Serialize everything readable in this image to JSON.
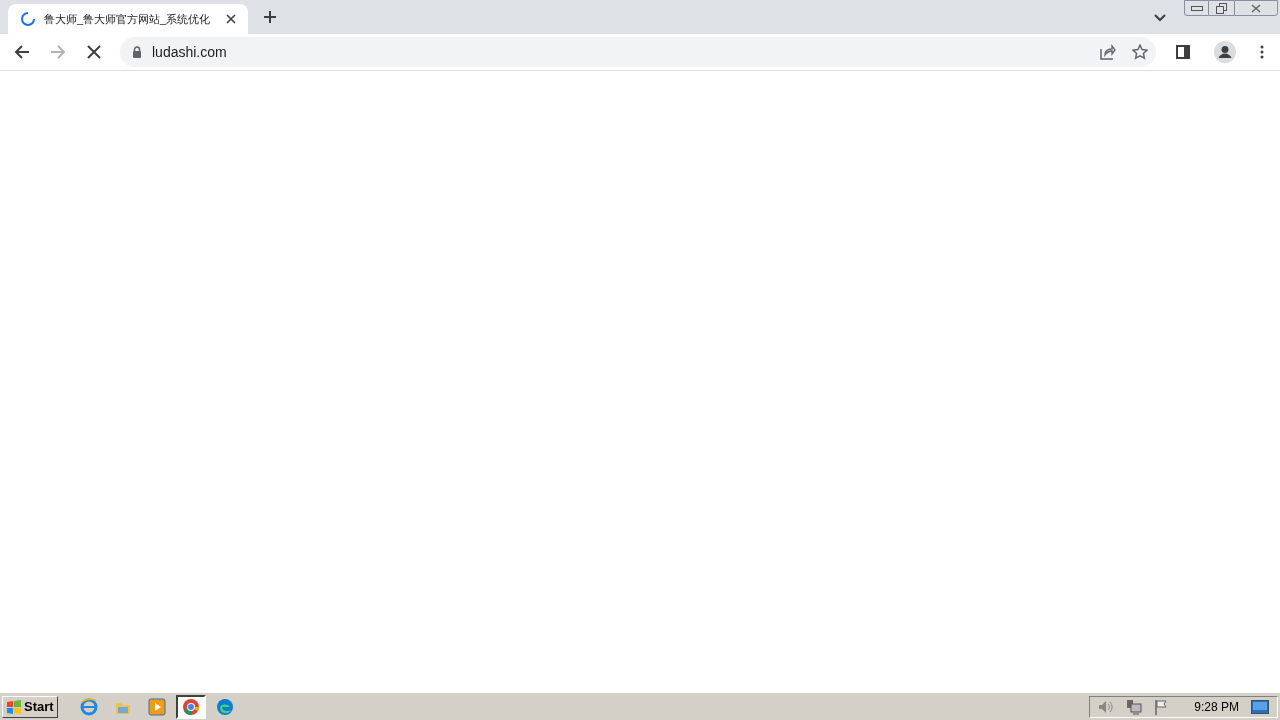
{
  "tabs": [
    {
      "title": "鲁大师_鲁大师官方网站_系统优化",
      "loading": true,
      "selected": true
    }
  ],
  "address_bar": {
    "url": "ludashi.com"
  },
  "page_loading": true,
  "taskbar": {
    "start_label": "Start",
    "apps": [
      {
        "kind": "ie",
        "selected": false
      },
      {
        "kind": "explorer",
        "selected": false
      },
      {
        "kind": "media",
        "selected": false
      },
      {
        "kind": "chrome",
        "selected": true
      },
      {
        "kind": "edge",
        "selected": false
      }
    ],
    "clock": "9:28 PM"
  }
}
